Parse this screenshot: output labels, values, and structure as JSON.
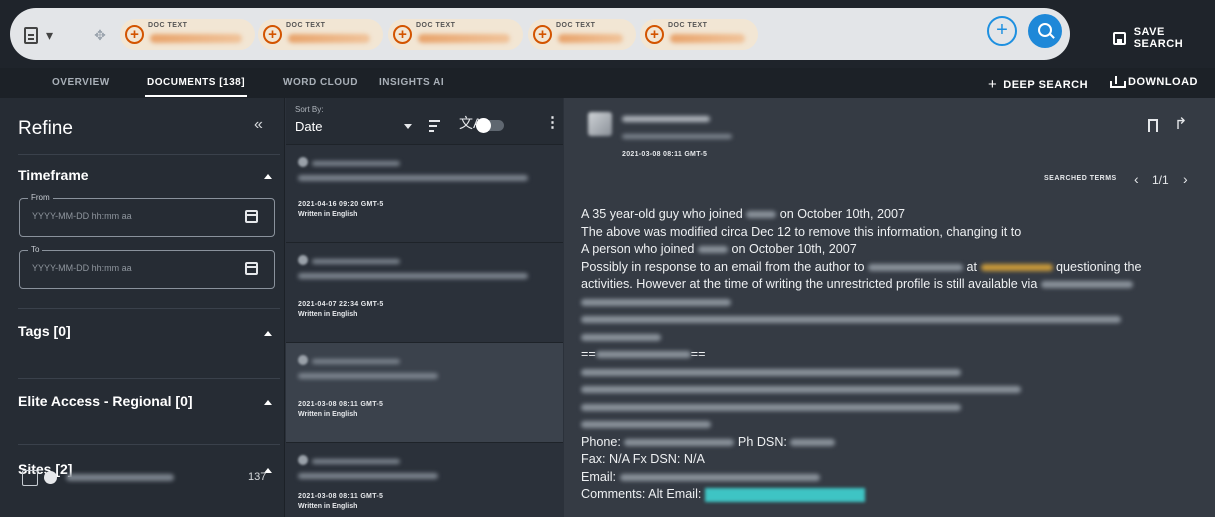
{
  "topbar": {
    "chips": [
      {
        "label": "DOC TEXT"
      },
      {
        "label": "DOC TEXT"
      },
      {
        "label": "DOC TEXT"
      },
      {
        "label": "DOC TEXT"
      },
      {
        "label": "DOC TEXT"
      }
    ],
    "save_search_label": "SAVE SEARCH",
    "add_icon": "plus-circle-icon",
    "search_icon": "search-icon"
  },
  "tabs": {
    "overview": "OVERVIEW",
    "documents": "DOCUMENTS [138]",
    "word_cloud": "WORD CLOUD",
    "insights": "INSIGHTS AI",
    "deep_search": "DEEP SEARCH",
    "download": "DOWNLOAD"
  },
  "refine": {
    "title": "Refine",
    "collapse": "«",
    "timeframe": {
      "title": "Timeframe",
      "from_label": "From",
      "from_placeholder": "YYYY-MM-DD hh:mm aa",
      "to_label": "To",
      "to_placeholder": "YYYY-MM-DD hh:mm aa"
    },
    "tags_title": "Tags [0]",
    "elite_title": "Elite Access - Regional [0]",
    "sites_title": "Sites [2]",
    "site_count": "137"
  },
  "doclist": {
    "sort_label": "Sort By:",
    "sort_value": "Date",
    "cards": [
      {
        "date": "2021-04-16 09:20 GMT-5",
        "lang": "Written in English"
      },
      {
        "date": "2021-04-07 22:34 GMT-5",
        "lang": "Written in English"
      },
      {
        "date": "2021-03-08 08:11 GMT-5",
        "lang": "Written in English"
      },
      {
        "date": "2021-03-08 08:11 GMT-5",
        "lang": "Written in English"
      }
    ]
  },
  "viewer": {
    "date": "2021-03-08 08:11 GMT-5",
    "searched_terms": "SEARCHED TERMS",
    "counter": "1/1",
    "lines": {
      "l1a": "A 35 year-old guy who joined",
      "l1b": "on October 10th, 2007",
      "l2": "The above was modified circa Dec 12 to remove this information, changing it to",
      "l3a": "A person who joined",
      "l3b": "on October 10th, 2007",
      "l4a": "Possibly in response to an email from the author to",
      "l4b": "at",
      "l4c": "questioning the",
      "l5": "activities. However at the time of writing the unrestricted profile is still available via",
      "l9": "==",
      "l9b": "==",
      "l14a": "Phone:",
      "l14b": "Ph DSN:",
      "l15": "Fax: N/A Fx DSN: N/A",
      "l16": "Email:",
      "l17": "Comments: Alt Email:"
    }
  },
  "colors": {
    "accent": "#1e88d8",
    "chip_plus": "#d35400",
    "highlight": "#3ec4c4"
  }
}
